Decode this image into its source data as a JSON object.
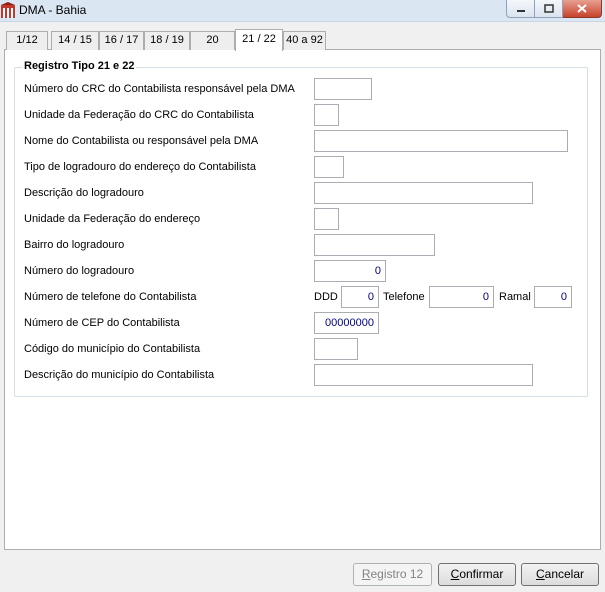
{
  "window": {
    "title": "DMA - Bahia"
  },
  "tabs": [
    {
      "label": "1/12"
    },
    {
      "label": "14 / 15"
    },
    {
      "label": "16 / 17"
    },
    {
      "label": "18 / 19"
    },
    {
      "label": "20"
    },
    {
      "label": "21 / 22",
      "active": true
    },
    {
      "label": "40 a 92"
    }
  ],
  "group": {
    "title": "Registro Tipo 21 e 22"
  },
  "fields": {
    "crc_numero": {
      "label": "Número do CRC do Contabilista responsável pela DMA",
      "value": ""
    },
    "crc_uf": {
      "label": "Unidade da Federação do CRC do Contabilista",
      "value": ""
    },
    "nome": {
      "label": "Nome do Contabilista ou responsável pela DMA",
      "value": ""
    },
    "tipo_logradouro": {
      "label": "Tipo de logradouro do endereço do Contabilista",
      "value": ""
    },
    "descricao_logradouro": {
      "label": "Descrição do logradouro",
      "value": ""
    },
    "uf_endereco": {
      "label": "Unidade da Federação do endereço",
      "value": ""
    },
    "bairro": {
      "label": "Bairro do logradouro",
      "value": ""
    },
    "numero": {
      "label": "Número do logradouro",
      "value": "0"
    },
    "telefone": {
      "label": "Número de telefone do Contabilista",
      "ddd_label": "DDD",
      "ddd_value": "0",
      "telefone_label": "Telefone",
      "telefone_value": "0",
      "ramal_label": "Ramal",
      "ramal_value": "0"
    },
    "cep": {
      "label": "Número de CEP do Contabilista",
      "value": "00000000"
    },
    "codigo_municipio": {
      "label": "Código do município do Contabilista",
      "value": ""
    },
    "descricao_municipio": {
      "label": "Descrição  do município do Contabilista",
      "value": ""
    }
  },
  "buttons": {
    "registro_prefix": "R",
    "registro_rest": "egistro 12",
    "confirmar_prefix": "C",
    "confirmar_rest": "onfirmar",
    "cancelar_prefix": "C",
    "cancelar_rest": "ancelar"
  },
  "colors": {
    "numeric_text": "#000080",
    "titlebar": "#dbe6f3"
  }
}
